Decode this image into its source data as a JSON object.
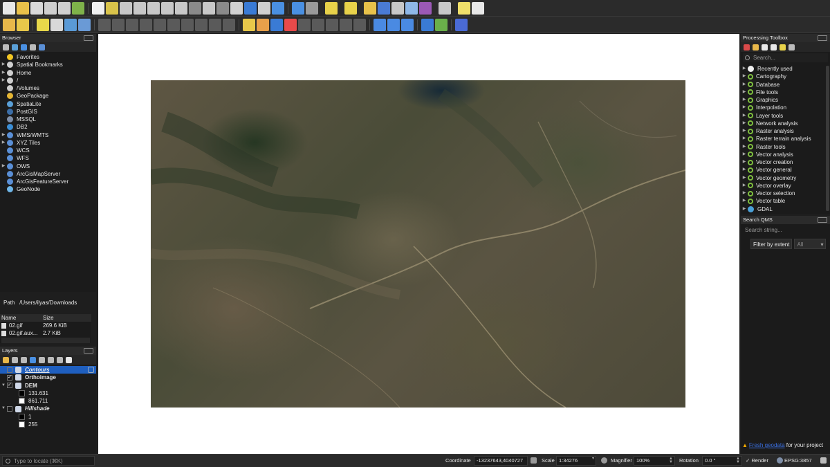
{
  "browser": {
    "title": "Browser",
    "items": [
      {
        "label": "Favorites",
        "icon": "star-icon",
        "arrow": "",
        "color": "#f3c623"
      },
      {
        "label": "Spatial Bookmarks",
        "icon": "bookmark-icon",
        "arrow": "▶",
        "color": "#cfcfcf"
      },
      {
        "label": "Home",
        "icon": "home-folder-icon",
        "arrow": "▶",
        "color": "#cfcfcf"
      },
      {
        "label": "/",
        "icon": "folder-icon",
        "arrow": "▶",
        "color": "#cfcfcf"
      },
      {
        "label": "/Volumes",
        "icon": "folder-icon",
        "arrow": "",
        "color": "#cfcfcf"
      },
      {
        "label": "GeoPackage",
        "icon": "geopackage-icon",
        "arrow": "",
        "color": "#e6b634"
      },
      {
        "label": "SpatiaLite",
        "icon": "spatialite-icon",
        "arrow": "",
        "color": "#5aa0d8"
      },
      {
        "label": "PostGIS",
        "icon": "postgis-icon",
        "arrow": "",
        "color": "#3b6ea8"
      },
      {
        "label": "MSSQL",
        "icon": "mssql-icon",
        "arrow": "",
        "color": "#7f8fa8"
      },
      {
        "label": "DB2",
        "icon": "db2-icon",
        "arrow": "",
        "color": "#3c8fd6"
      },
      {
        "label": "WMS/WMTS",
        "icon": "globe-icon",
        "arrow": "▶",
        "color": "#5a8fd6"
      },
      {
        "label": "XYZ Tiles",
        "icon": "grid-globe-icon",
        "arrow": "▶",
        "color": "#5a8fd6"
      },
      {
        "label": "WCS",
        "icon": "globe-icon",
        "arrow": "",
        "color": "#5a8fd6"
      },
      {
        "label": "WFS",
        "icon": "globe-icon",
        "arrow": "",
        "color": "#5a8fd6"
      },
      {
        "label": "OWS",
        "icon": "globe-icon",
        "arrow": "▶",
        "color": "#5a8fd6"
      },
      {
        "label": "ArcGisMapServer",
        "icon": "arcgis-icon",
        "arrow": "",
        "color": "#5a8fd6"
      },
      {
        "label": "ArcGisFeatureServer",
        "icon": "arcgis-icon",
        "arrow": "",
        "color": "#5a8fd6"
      },
      {
        "label": "GeoNode",
        "icon": "geonode-icon",
        "arrow": "",
        "color": "#6fb6e8"
      }
    ]
  },
  "path": {
    "label": "Path",
    "value": "/Users/ilyas/Downloads"
  },
  "files": {
    "headers": [
      "Name",
      "Size"
    ],
    "rows": [
      {
        "name": "02.gif",
        "size": "269.6 KiB"
      },
      {
        "name": "02.gif.aux...",
        "size": "2.7 KiB"
      }
    ]
  },
  "layers": {
    "title": "Layers",
    "items": [
      {
        "label": "Contours",
        "checked": false,
        "arrow": "",
        "style": "italic-bold",
        "selected": true,
        "kind": "layer"
      },
      {
        "label": "Orthoimage",
        "checked": true,
        "arrow": "",
        "style": "bold",
        "selected": false,
        "kind": "layer"
      },
      {
        "label": "DEM",
        "checked": true,
        "arrow": "▼",
        "style": "bold",
        "selected": false,
        "kind": "layer"
      },
      {
        "label": "131.631",
        "kind": "legend",
        "swatch": "#000000"
      },
      {
        "label": "861.711",
        "kind": "legend",
        "swatch": "#ffffff"
      },
      {
        "label": "Hillshade",
        "checked": false,
        "arrow": "▼",
        "style": "italic-bold",
        "selected": false,
        "kind": "layer"
      },
      {
        "label": "1",
        "kind": "legend",
        "swatch": "#000000"
      },
      {
        "label": "255",
        "kind": "legend",
        "swatch": "#ffffff"
      }
    ]
  },
  "toolbox": {
    "title": "Processing Toolbox",
    "search_placeholder": "Search...",
    "items": [
      {
        "label": "Recently used",
        "icon": "clock-icon"
      },
      {
        "label": "Cartography",
        "icon": "qgis-icon"
      },
      {
        "label": "Database",
        "icon": "qgis-icon"
      },
      {
        "label": "File tools",
        "icon": "qgis-icon"
      },
      {
        "label": "Graphics",
        "icon": "qgis-icon"
      },
      {
        "label": "Interpolation",
        "icon": "qgis-icon"
      },
      {
        "label": "Layer tools",
        "icon": "qgis-icon"
      },
      {
        "label": "Network analysis",
        "icon": "qgis-icon"
      },
      {
        "label": "Raster analysis",
        "icon": "qgis-icon"
      },
      {
        "label": "Raster terrain analysis",
        "icon": "qgis-icon"
      },
      {
        "label": "Raster tools",
        "icon": "qgis-icon"
      },
      {
        "label": "Vector analysis",
        "icon": "qgis-icon"
      },
      {
        "label": "Vector creation",
        "icon": "qgis-icon"
      },
      {
        "label": "Vector general",
        "icon": "qgis-icon"
      },
      {
        "label": "Vector geometry",
        "icon": "qgis-icon"
      },
      {
        "label": "Vector overlay",
        "icon": "qgis-icon"
      },
      {
        "label": "Vector selection",
        "icon": "qgis-icon"
      },
      {
        "label": "Vector table",
        "icon": "qgis-icon"
      },
      {
        "label": "GDAL",
        "icon": "gdal-icon"
      }
    ]
  },
  "qms": {
    "title": "Search QMS",
    "search_placeholder": "Search string...",
    "filter_button": "Filter by extent",
    "filter_select": "All",
    "footer_link": "Fresh geodata",
    "footer_text": " for your project"
  },
  "status": {
    "locate_placeholder": "Type to locate (⌘K)",
    "coordinate_label": "Coordinate",
    "coordinate_value": "-13237643,4040727",
    "scale_label": "Scale",
    "scale_value": "1:34276",
    "magnifier_label": "Magnifier",
    "magnifier_value": "100%",
    "rotation_label": "Rotation",
    "rotation_value": "0.0 °",
    "render_label": "Render",
    "crs_value": "EPSG:3857"
  }
}
